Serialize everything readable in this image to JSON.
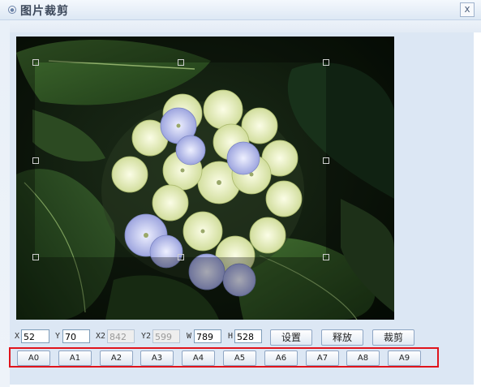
{
  "dialog": {
    "title": "图片裁剪",
    "close_label": "x"
  },
  "fields": {
    "x": {
      "label": "X",
      "value": "52"
    },
    "y": {
      "label": "Y",
      "value": "70"
    },
    "x2": {
      "label": "X2",
      "value": "842"
    },
    "y2": {
      "label": "Y2",
      "value": "599"
    },
    "w": {
      "label": "W",
      "value": "789"
    },
    "h": {
      "label": "H",
      "value": "528"
    }
  },
  "buttons": {
    "set": "设置",
    "release": "释放",
    "crop": "裁剪"
  },
  "presets": [
    "A0",
    "A1",
    "A2",
    "A3",
    "A4",
    "A5",
    "A6",
    "A7",
    "A8",
    "A9"
  ],
  "colors": {
    "highlight_border": "#e0141c",
    "panel_bg": "#dce7f4"
  },
  "icons": {
    "title": "circle-dot-icon",
    "close": "close-icon"
  }
}
